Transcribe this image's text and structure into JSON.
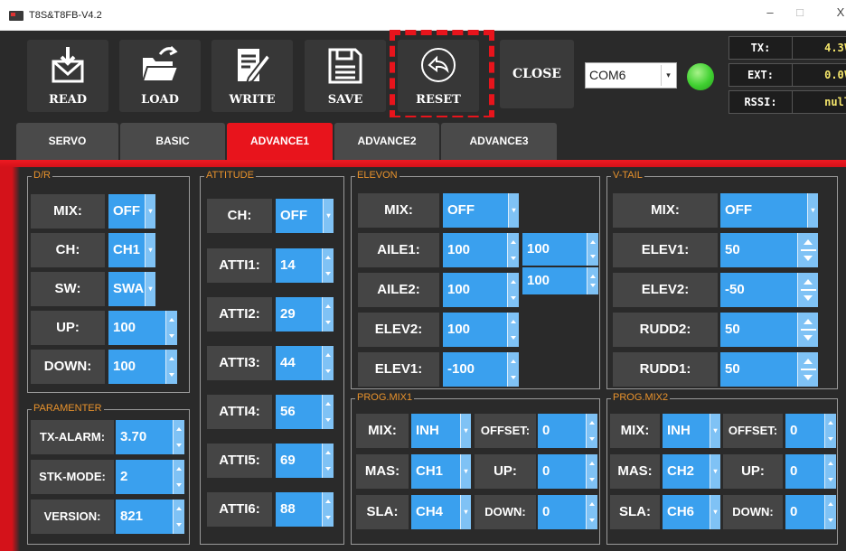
{
  "window": {
    "title": "T8S&T8FB-V4.2",
    "min": "–",
    "max": "□",
    "close": "X"
  },
  "toolbar": {
    "read": "READ",
    "load": "LOAD",
    "write": "WRITE",
    "save": "SAVE",
    "reset": "RESET",
    "close": "CLOSE",
    "port": "COM6",
    "status": [
      {
        "k": "TX:",
        "v": "4.3V"
      },
      {
        "k": "EXT:",
        "v": "0.0V"
      },
      {
        "k": "RSSI:",
        "v": "null"
      }
    ]
  },
  "tabs": [
    "SERVO",
    "BASIC",
    "ADVANCE1",
    "ADVANCE2",
    "ADVANCE3"
  ],
  "dr": {
    "title": "D/R",
    "rows": [
      {
        "l": "MIX:",
        "v": "OFF"
      },
      {
        "l": "CH:",
        "v": "CH1"
      },
      {
        "l": "SW:",
        "v": "SWA"
      },
      {
        "l": "UP:",
        "v": "100"
      },
      {
        "l": "DOWN:",
        "v": "100"
      }
    ]
  },
  "attitude": {
    "title": "ATTITUDE",
    "rows": [
      {
        "l": "CH:",
        "v": "OFF"
      },
      {
        "l": "ATTI1:",
        "v": "14"
      },
      {
        "l": "ATTI2:",
        "v": "29"
      },
      {
        "l": "ATTI3:",
        "v": "44"
      },
      {
        "l": "ATTI4:",
        "v": "56"
      },
      {
        "l": "ATTI5:",
        "v": "69"
      },
      {
        "l": "ATTI6:",
        "v": "88"
      }
    ]
  },
  "elevon": {
    "title": "ELEVON",
    "rows": [
      {
        "l": "MIX:",
        "v": "OFF"
      },
      {
        "l": "AILE1:",
        "v": "100"
      },
      {
        "l": "AILE2:",
        "v": "100"
      },
      {
        "l": "ELEV2:",
        "v": "100"
      },
      {
        "l": "ELEV1:",
        "v": "-100"
      }
    ],
    "extra": [
      "100",
      "100"
    ]
  },
  "vtail": {
    "title": "V-TAIL",
    "rows": [
      {
        "l": "MIX:",
        "v": "OFF"
      },
      {
        "l": "ELEV1:",
        "v": "50"
      },
      {
        "l": "ELEV2:",
        "v": "-50"
      },
      {
        "l": "RUDD2:",
        "v": "50"
      },
      {
        "l": "RUDD1:",
        "v": "50"
      }
    ]
  },
  "param": {
    "title": "PARAMENTER",
    "rows": [
      {
        "l": "TX-ALARM:",
        "v": "3.70"
      },
      {
        "l": "STK-MODE:",
        "v": "2"
      },
      {
        "l": "VERSION:",
        "v": "821"
      }
    ]
  },
  "pm1": {
    "title": "PROG.MIX1",
    "mix": "MIX:",
    "mix_v": "INH",
    "mas": "MAS:",
    "mas_v": "CH1",
    "sla": "SLA:",
    "sla_v": "CH4",
    "off": "OFFSET:",
    "off_v": "0",
    "up": "UP:",
    "up_v": "0",
    "down": "DOWN:",
    "down_v": "0"
  },
  "pm2": {
    "title": "PROG.MIX2",
    "mix": "MIX:",
    "mix_v": "INH",
    "mas": "MAS:",
    "mas_v": "CH2",
    "sla": "SLA:",
    "sla_v": "CH6",
    "off": "OFFSET:",
    "off_v": "0",
    "up": "UP:",
    "up_v": "0",
    "down": "DOWN:",
    "down_v": "0"
  },
  "colors": {
    "accent": "#e8141c",
    "field": "#3aa0ee",
    "label_bg": "#454545",
    "status_value": "#f5e66b",
    "group_title": "#e8922c"
  }
}
